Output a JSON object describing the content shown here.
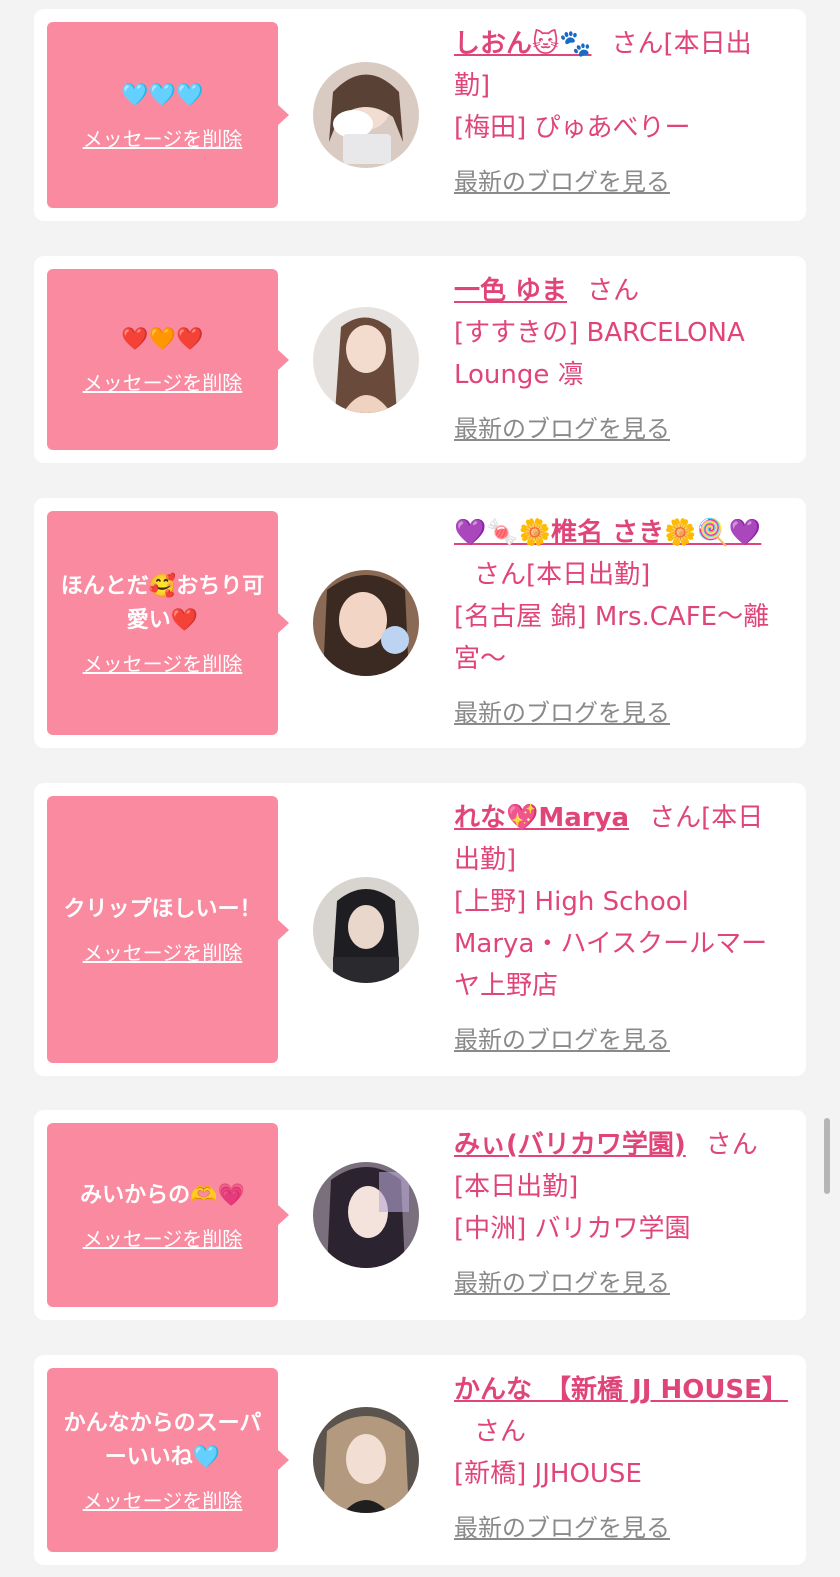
{
  "delete_label": "メッセージを削除",
  "blog_label": "最新のブログを見る",
  "san": "さん",
  "cards": [
    {
      "message": "🩵🩵🩵",
      "name": "しおん🐱🐾",
      "status": "[本日出勤]",
      "shop": "[梅田] ぴゅあべりー"
    },
    {
      "message": "❤️🧡❤️",
      "name": "一色 ゆま",
      "status": "",
      "shop": "[すすきの] BARCELONA Lounge 凛"
    },
    {
      "message": "ほんとだ🥰おちり可愛い❤️",
      "name": "💜🍬🌼椎名 さき🌼🍭💜",
      "status": "[本日出勤]",
      "shop": "[名古屋 錦] Mrs.CAFE～離宮～"
    },
    {
      "message": "クリップほしいー！",
      "name": "れな💖Marya",
      "status": "[本日出勤]",
      "shop": "[上野] High School Marya・ハイスクールマーヤ上野店"
    },
    {
      "message": "みいからの🫶💗",
      "name": "みぃ(バリカワ学園)",
      "status": "[本日出勤]",
      "shop": "[中洲] バリカワ学園"
    },
    {
      "message": "かんなからのスーパーいいね🩵",
      "name": "かんな　【新橋 JJ HOUSE】",
      "status": "",
      "shop": "[新橋] JJHOUSE"
    }
  ],
  "colors": {
    "accent": "#e0457a",
    "bubble": "#f98aa0",
    "link_gray": "#8a8a8a",
    "background": "#f3f3f3"
  }
}
